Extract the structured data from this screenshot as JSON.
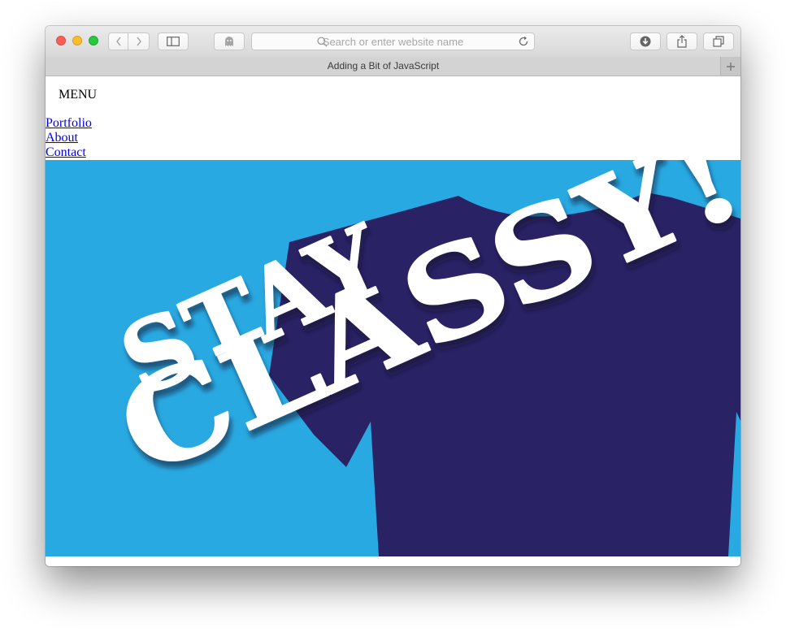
{
  "browser": {
    "search_placeholder": "Search or enter website name",
    "tab_title": "Adding a Bit of JavaScript"
  },
  "page": {
    "menu_label": "MENU",
    "nav_links": [
      "Portfolio",
      "About",
      "Contact"
    ],
    "hero": {
      "line1": "STAY",
      "line2": "CLASSY!",
      "colors": {
        "background": "#29a9e1",
        "shirt": "#292264",
        "text": "#ffffff"
      }
    }
  }
}
